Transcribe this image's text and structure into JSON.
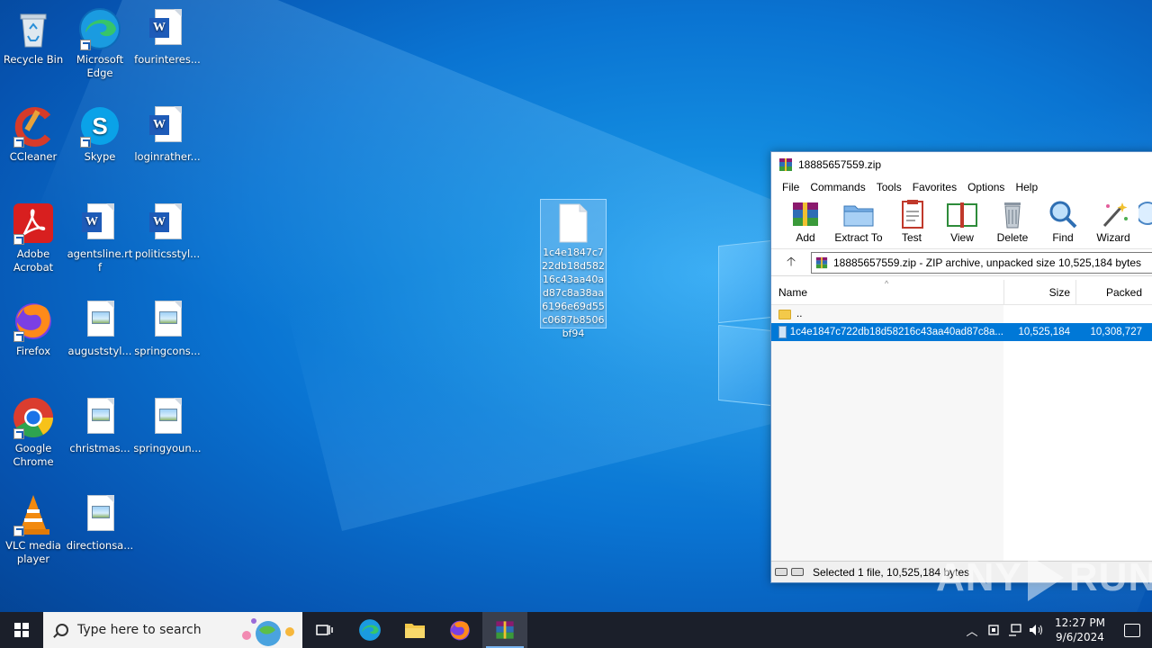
{
  "desktop": {
    "icons": [
      {
        "label": "Recycle Bin",
        "icon": "recycle-bin-icon"
      },
      {
        "label": "Microsoft Edge",
        "icon": "edge-icon"
      },
      {
        "label": "fourinteres...",
        "icon": "word-doc-icon"
      },
      {
        "label": "CCleaner",
        "icon": "ccleaner-icon"
      },
      {
        "label": "Skype",
        "icon": "skype-icon"
      },
      {
        "label": "loginrather...",
        "icon": "word-doc-icon"
      },
      {
        "label": "Adobe Acrobat",
        "icon": "acrobat-icon"
      },
      {
        "label": "agentsline.rtf",
        "icon": "word-doc-icon"
      },
      {
        "label": "politicsstyl...",
        "icon": "word-doc-icon"
      },
      {
        "label": "Firefox",
        "icon": "firefox-icon"
      },
      {
        "label": "auguststyl...",
        "icon": "image-file-icon"
      },
      {
        "label": "springcons...",
        "icon": "image-file-icon"
      },
      {
        "label": "Google Chrome",
        "icon": "chrome-icon"
      },
      {
        "label": "christmas...",
        "icon": "image-file-icon"
      },
      {
        "label": "springyoun...",
        "icon": "image-file-icon"
      },
      {
        "label": "VLC media player",
        "icon": "vlc-icon"
      },
      {
        "label": "directionsa...",
        "icon": "image-file-icon"
      }
    ],
    "selected_file": {
      "label": "1c4e1847c722db18d58216c43aa40ad87c8a38aa6196e69d55c0687b8506bf94"
    }
  },
  "winrar": {
    "title": "18885657559.zip",
    "menu": [
      "File",
      "Commands",
      "Tools",
      "Favorites",
      "Options",
      "Help"
    ],
    "toolbar": [
      "Add",
      "Extract To",
      "Test",
      "View",
      "Delete",
      "Find",
      "Wizard"
    ],
    "path": "18885657559.zip - ZIP archive, unpacked size 10,525,184 bytes",
    "columns": {
      "name": "Name",
      "size": "Size",
      "packed": "Packed"
    },
    "rows": [
      {
        "name": "..",
        "size": "",
        "packed": ""
      },
      {
        "name": "1c4e1847c722db18d58216c43aa40ad87c8a...",
        "size": "10,525,184",
        "packed": "10,308,727"
      }
    ],
    "status": "Selected 1 file, 10,525,184 bytes"
  },
  "watermark": {
    "left": "ANY",
    "right": "RUN"
  },
  "taskbar": {
    "search_placeholder": "Type here to search",
    "time": "12:27 PM",
    "date": "9/6/2024"
  },
  "colors": {
    "accent": "#0078d7",
    "taskbar": "#1b1f2a"
  }
}
